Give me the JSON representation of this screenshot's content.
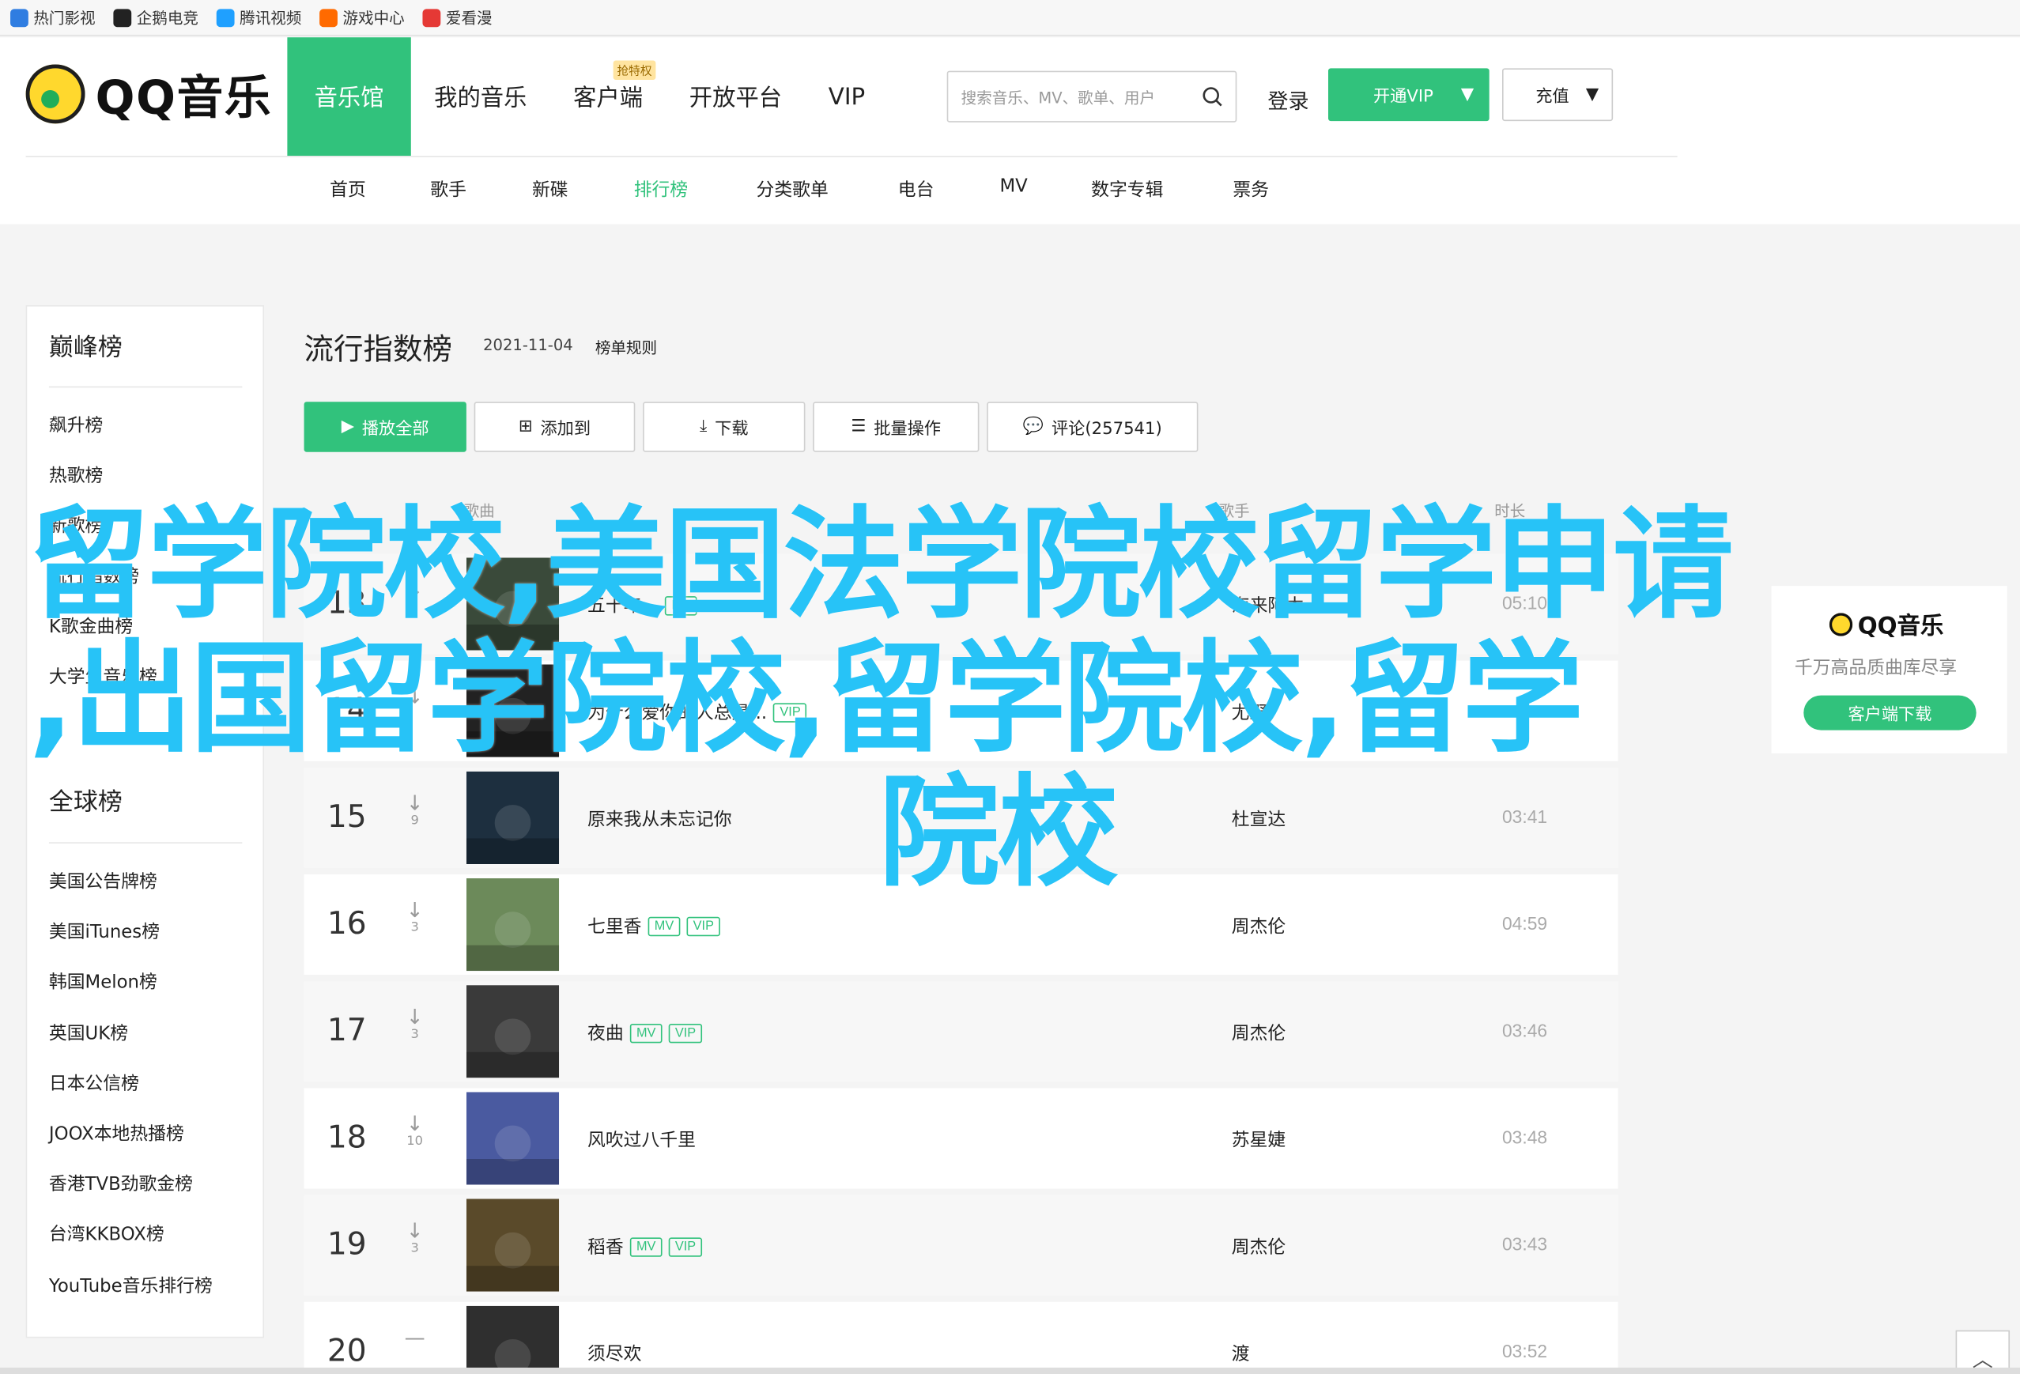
{
  "bookmarks": [
    {
      "label": "热门影视",
      "color": "#2f7de1",
      "icon": "video-icon"
    },
    {
      "label": "企鹅电竞",
      "color": "#222222",
      "icon": "penguin-icon"
    },
    {
      "label": "腾讯视频",
      "color": "#1fa0ff",
      "icon": "play-icon"
    },
    {
      "label": "游戏中心",
      "color": "#ff6a00",
      "icon": "gamepad-icon"
    },
    {
      "label": "爱看漫",
      "color": "#e53935",
      "icon": "comic-icon"
    }
  ],
  "header": {
    "logo_text": "QQ音乐",
    "nav": [
      {
        "label": "音乐馆",
        "active": true
      },
      {
        "label": "我的音乐"
      },
      {
        "label": "客户端",
        "badge": "抢特权"
      },
      {
        "label": "开放平台"
      },
      {
        "label": "VIP"
      }
    ],
    "search_placeholder": "搜索音乐、MV、歌单、用户",
    "login": "登录",
    "vip_btn": "开通VIP",
    "recharge_btn": "充值",
    "subnav": [
      {
        "label": "首页"
      },
      {
        "label": "歌手"
      },
      {
        "label": "新碟"
      },
      {
        "label": "排行榜",
        "active": true
      },
      {
        "label": "分类歌单"
      },
      {
        "label": "电台"
      },
      {
        "label": "MV"
      },
      {
        "label": "数字专辑"
      },
      {
        "label": "票务"
      }
    ]
  },
  "sidebar": {
    "section1_title": "巅峰榜",
    "section1_items": [
      "飙升榜",
      "热歌榜",
      "新歌榜",
      "流行指数榜",
      "K歌金曲榜",
      "大学生音乐榜"
    ],
    "section2_title": "全球榜",
    "section2_items": [
      "美国公告牌榜",
      "美国iTunes榜",
      "韩国Melon榜",
      "英国UK榜",
      "日本公信榜",
      "JOOX本地热播榜",
      "香港TVB劲歌金榜",
      "台湾KKBOX榜",
      "YouTube音乐排行榜"
    ]
  },
  "main": {
    "title": "流行指数榜",
    "date": "2021-11-04",
    "rule_link": "榜单规则",
    "buttons": {
      "play_all": "播放全部",
      "add_to": "添加到",
      "download": "下载",
      "batch": "批量操作",
      "comments": "评论(257541)"
    },
    "columns": {
      "song": "歌曲",
      "singer": "歌手",
      "duration": "时长"
    },
    "rows": [
      {
        "rank": "13",
        "trend": "↓",
        "change": "",
        "song": "五十年...",
        "mv": true,
        "vip": false,
        "singer": "海来阿木",
        "duration": "05:10",
        "cover": "#3a4a3a"
      },
      {
        "rank": "14",
        "trend": "↓",
        "change": "",
        "song": "为什么爱你的人总是...",
        "mv": false,
        "vip": true,
        "singer": "尤野",
        "duration": "",
        "cover": "#222222"
      },
      {
        "rank": "15",
        "trend": "↓",
        "change": "9",
        "song": "原来我从未忘记你",
        "mv": false,
        "vip": false,
        "singer": "杜宣达",
        "duration": "03:41",
        "cover": "#1d2f3f"
      },
      {
        "rank": "16",
        "trend": "↓",
        "change": "3",
        "song": "七里香",
        "mv": true,
        "vip": true,
        "singer": "周杰伦",
        "duration": "04:59",
        "cover": "#6c8a5a"
      },
      {
        "rank": "17",
        "trend": "↓",
        "change": "3",
        "song": "夜曲",
        "mv": true,
        "vip": true,
        "singer": "周杰伦",
        "duration": "03:46",
        "cover": "#3a3a3a"
      },
      {
        "rank": "18",
        "trend": "↓",
        "change": "10",
        "song": "风吹过八千里",
        "mv": false,
        "vip": false,
        "singer": "苏星婕",
        "duration": "03:48",
        "cover": "#4a5aa0"
      },
      {
        "rank": "19",
        "trend": "↓",
        "change": "3",
        "song": "稻香",
        "mv": true,
        "vip": true,
        "singer": "周杰伦",
        "duration": "03:43",
        "cover": "#5a4a2a"
      },
      {
        "rank": "20",
        "trend": "—",
        "change": "",
        "song": "须尽欢",
        "mv": false,
        "vip": false,
        "singer": "渡",
        "duration": "03:52",
        "cover": "#2f2f2f"
      }
    ]
  },
  "ad": {
    "logo_text": "QQ音乐",
    "subtitle": "千万高品质曲库尽享",
    "button": "客户端下载"
  },
  "overlay": {
    "line1": "留学院校,美国法学院校留学申请",
    "line2": ",出国留学院校,留学院校,留学",
    "line3": "院校"
  },
  "tags": {
    "mv": "MV",
    "vip": "VIP"
  },
  "colors": {
    "accent": "#31c27c",
    "overlay": "#27c3f7"
  }
}
